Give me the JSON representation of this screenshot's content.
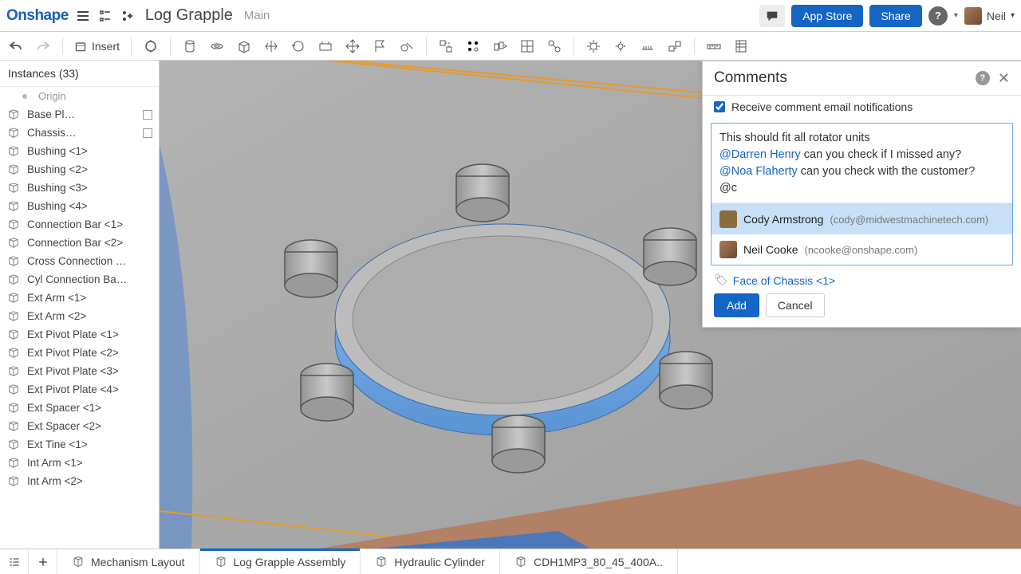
{
  "app": {
    "logo": "Onshape",
    "title": "Log Grapple",
    "subtitle": "Main"
  },
  "topbar": {
    "appstore": "App Store",
    "share": "Share",
    "username": "Neil"
  },
  "toolbar": {
    "insert": "Insert"
  },
  "sidebar": {
    "header": "Instances (33)",
    "origin": "Origin",
    "items": [
      {
        "label": "Base Pl…",
        "badge": true
      },
      {
        "label": "Chassis…",
        "badge": true
      },
      {
        "label": "Bushing <1>"
      },
      {
        "label": "Bushing <2>"
      },
      {
        "label": "Bushing <3>"
      },
      {
        "label": "Bushing <4>"
      },
      {
        "label": "Connection Bar <1>"
      },
      {
        "label": "Connection Bar <2>"
      },
      {
        "label": "Cross Connection …"
      },
      {
        "label": "Cyl Connection Ba…"
      },
      {
        "label": "Ext Arm <1>"
      },
      {
        "label": "Ext Arm <2>"
      },
      {
        "label": "Ext Pivot Plate <1>"
      },
      {
        "label": "Ext Pivot Plate <2>"
      },
      {
        "label": "Ext Pivot Plate <3>"
      },
      {
        "label": "Ext Pivot Plate <4>"
      },
      {
        "label": "Ext Spacer <1>"
      },
      {
        "label": "Ext Spacer <2>"
      },
      {
        "label": "Ext Tine <1>"
      },
      {
        "label": "Int Arm <1>"
      },
      {
        "label": "Int Arm <2>"
      }
    ]
  },
  "comments": {
    "title": "Comments",
    "notify_label": "Receive comment email notifications",
    "notify_checked": true,
    "draft": {
      "line1": "This should fit all rotator units",
      "mention1": "@Darren Henry",
      "line2_rest": " can you check if I missed any?",
      "mention2": "@Noa Flaherty",
      "line3_rest": " can you check with the customer?",
      "typed": "@c"
    },
    "suggestions": [
      {
        "name": "Cody Armstrong",
        "email": "(cody@midwestmachinetech.com)",
        "selected": true
      },
      {
        "name": "Neil Cooke",
        "email": "(ncooke@onshape.com)",
        "selected": false
      }
    ],
    "reference": "Face of Chassis <1>",
    "add": "Add",
    "cancel": "Cancel"
  },
  "tabs": [
    {
      "label": "Mechanism Layout"
    },
    {
      "label": "Log Grapple Assembly",
      "active": true
    },
    {
      "label": "Hydraulic Cylinder"
    },
    {
      "label": "CDH1MP3_80_45_400A.."
    }
  ]
}
